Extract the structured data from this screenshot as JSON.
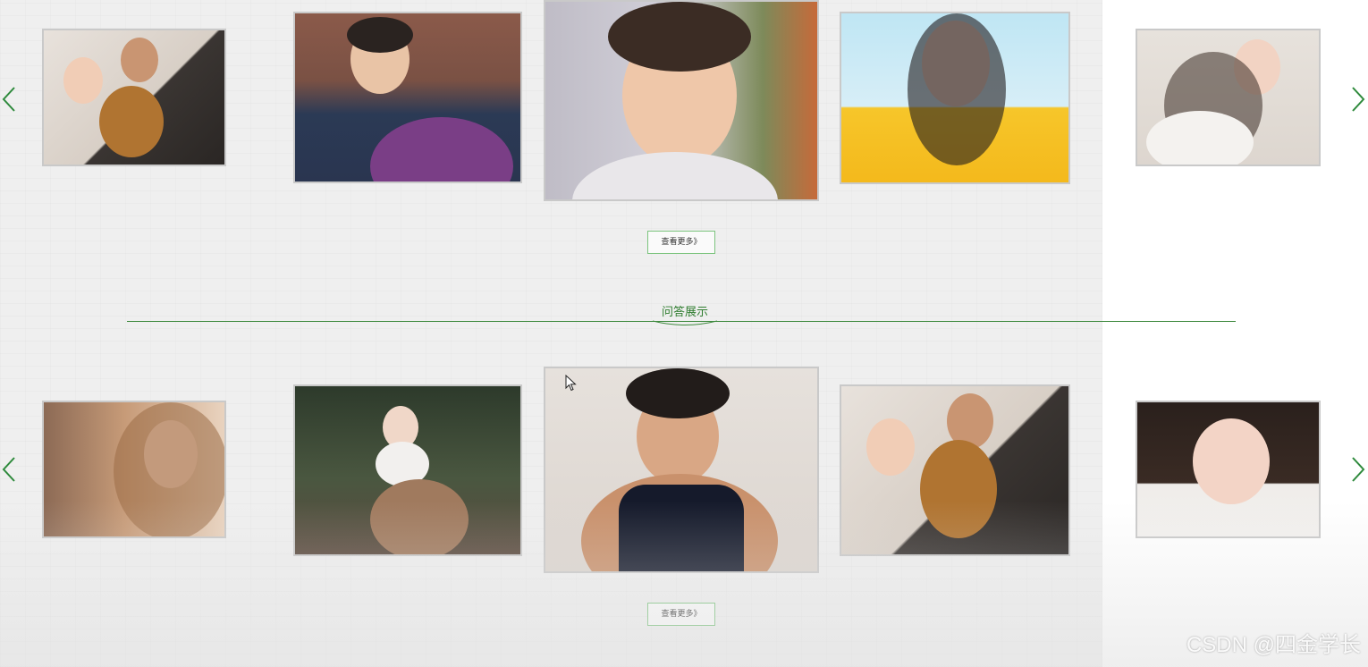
{
  "gallery_top": {
    "more_label": "查看更多》",
    "photos": [
      {
        "icon": "couple-with-dog-photo"
      },
      {
        "icon": "boy-with-backpack-photo"
      },
      {
        "icon": "boy-with-flower-photo"
      },
      {
        "icon": "girl-yellow-shirt-photo"
      },
      {
        "icon": "girl-long-hair-photo"
      }
    ]
  },
  "section": {
    "title": "问答展示"
  },
  "gallery_bottom": {
    "more_label": "查看更多》",
    "photos": [
      {
        "icon": "girl-sunlight-photo"
      },
      {
        "icon": "girl-sitting-forest-photo"
      },
      {
        "icon": "man-black-tank-photo"
      },
      {
        "icon": "couple-with-dog-photo"
      },
      {
        "icon": "girl-smiling-photo"
      }
    ]
  },
  "watermark": "CSDN @四金学长",
  "colors": {
    "accent_green": "#2f7d2f",
    "button_border": "#7cc47e",
    "card_border": "#c9c9c9"
  }
}
